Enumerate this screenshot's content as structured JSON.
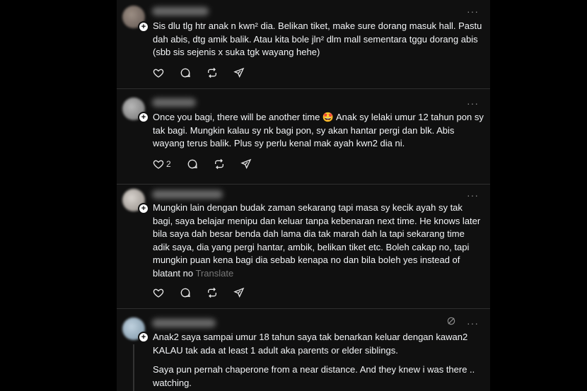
{
  "posts": [
    {
      "text": "Sis dlu tlg htr anak n kwn² dia. Belikan tiket, make sure dorang masuk hall. Pastu dah abis, dtg amik balik. Atau kita bole jln² dlm mall sementara tggu dorang abis (sbb sis sejenis x suka tgk wayang hehe)",
      "like_count": "",
      "avatar_color": "#7d6f66"
    },
    {
      "text": "Once you bagi, there will be another time 🤩  Anak sy lelaki umur 12 tahun pon sy tak bagi. Mungkin kalau sy nk bagi pon, sy akan hantar pergi dan blk. Abis wayang terus balik. Plus sy perlu kenal mak ayah kwn2 dia ni.",
      "like_count": "2",
      "avatar_color": "#9a9a9a"
    },
    {
      "text": "Mungkin lain dengan budak zaman sekarang tapi masa sy kecik ayah sy tak bagi, saya belajar menipu dan keluar tanpa kebenaran next time. He knows later bila saya dah besar benda dah lama dia tak marah dah la tapi sekarang time adik saya, dia yang pergi hantar, ambik, belikan tiket etc. Boleh cakap no, tapi mungkin puan kena bagi dia sebab kenapa no dan bila boleh yes instead of blatant no",
      "translate": "Translate",
      "like_count": "",
      "avatar_color": "#b7b2ad"
    },
    {
      "paragraph1": "Anak2 saya sampai umur 18 tahun saya tak benarkan keluar dengan kawan2 KALAU tak ada at least 1 adult aka parents or elder siblings.",
      "paragraph2": "Saya pun pernah chaperone from a near distance. And they knew i was there .. watching.",
      "avatar_color": "#9fb4c4"
    }
  ],
  "more_glyph": "···",
  "plus_glyph": "+",
  "icons": [
    "heart-icon",
    "comment-icon",
    "repost-icon",
    "share-icon",
    "mute-icon"
  ]
}
